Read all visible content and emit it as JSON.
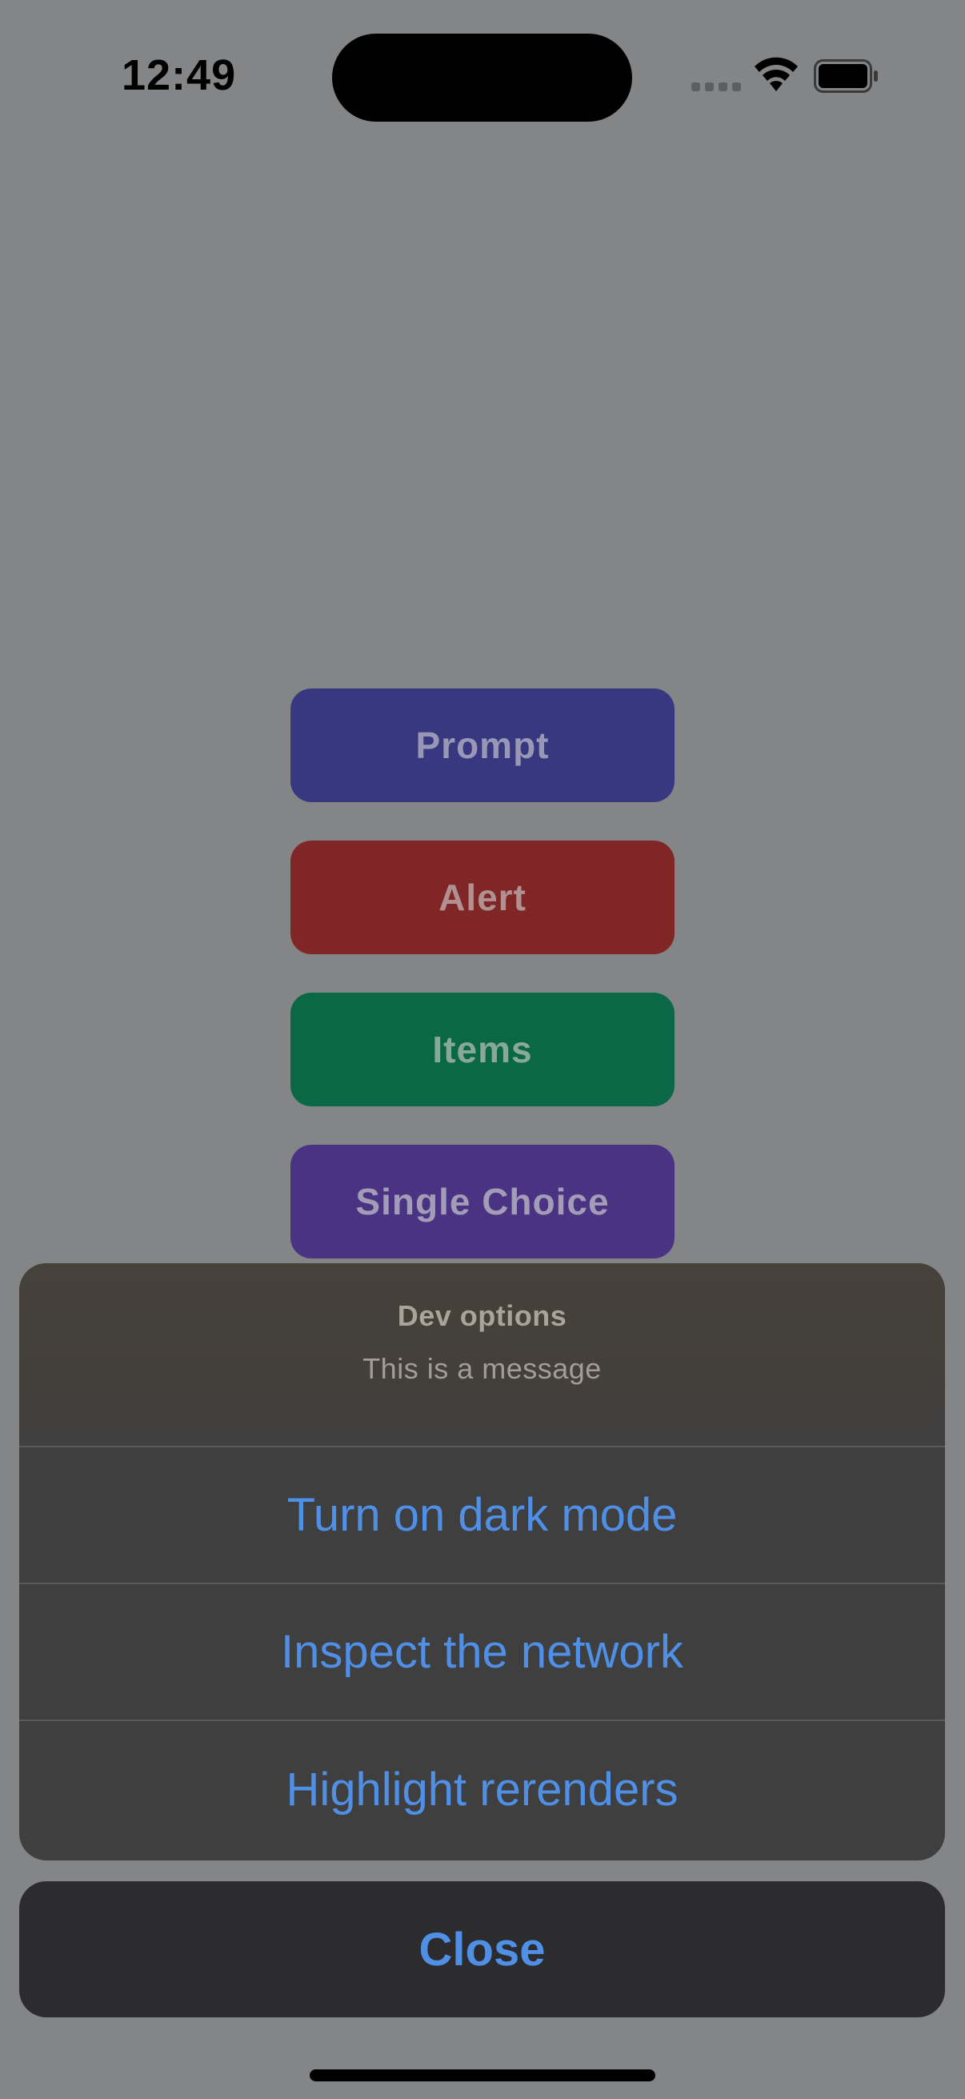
{
  "status_bar": {
    "time": "12:49",
    "icons": [
      "cellular-signal-icon",
      "wifi-icon",
      "battery-icon"
    ]
  },
  "background_buttons": [
    {
      "label": "Prompt",
      "color": "#3f3fa8"
    },
    {
      "label": "Alert",
      "color": "#b32a2a"
    },
    {
      "label": "Items",
      "color": "#0a8a5c"
    },
    {
      "label": "Single Choice",
      "color": "#6a44b8"
    }
  ],
  "action_sheet": {
    "title": "Dev options",
    "message": "This is a message",
    "actions": [
      {
        "label": "Turn on dark mode"
      },
      {
        "label": "Inspect the network"
      },
      {
        "label": "Highlight rerenders"
      }
    ],
    "cancel_label": "Close"
  },
  "colors": {
    "action_text": "#4f8fe6",
    "overlay_dim": "#848587"
  }
}
